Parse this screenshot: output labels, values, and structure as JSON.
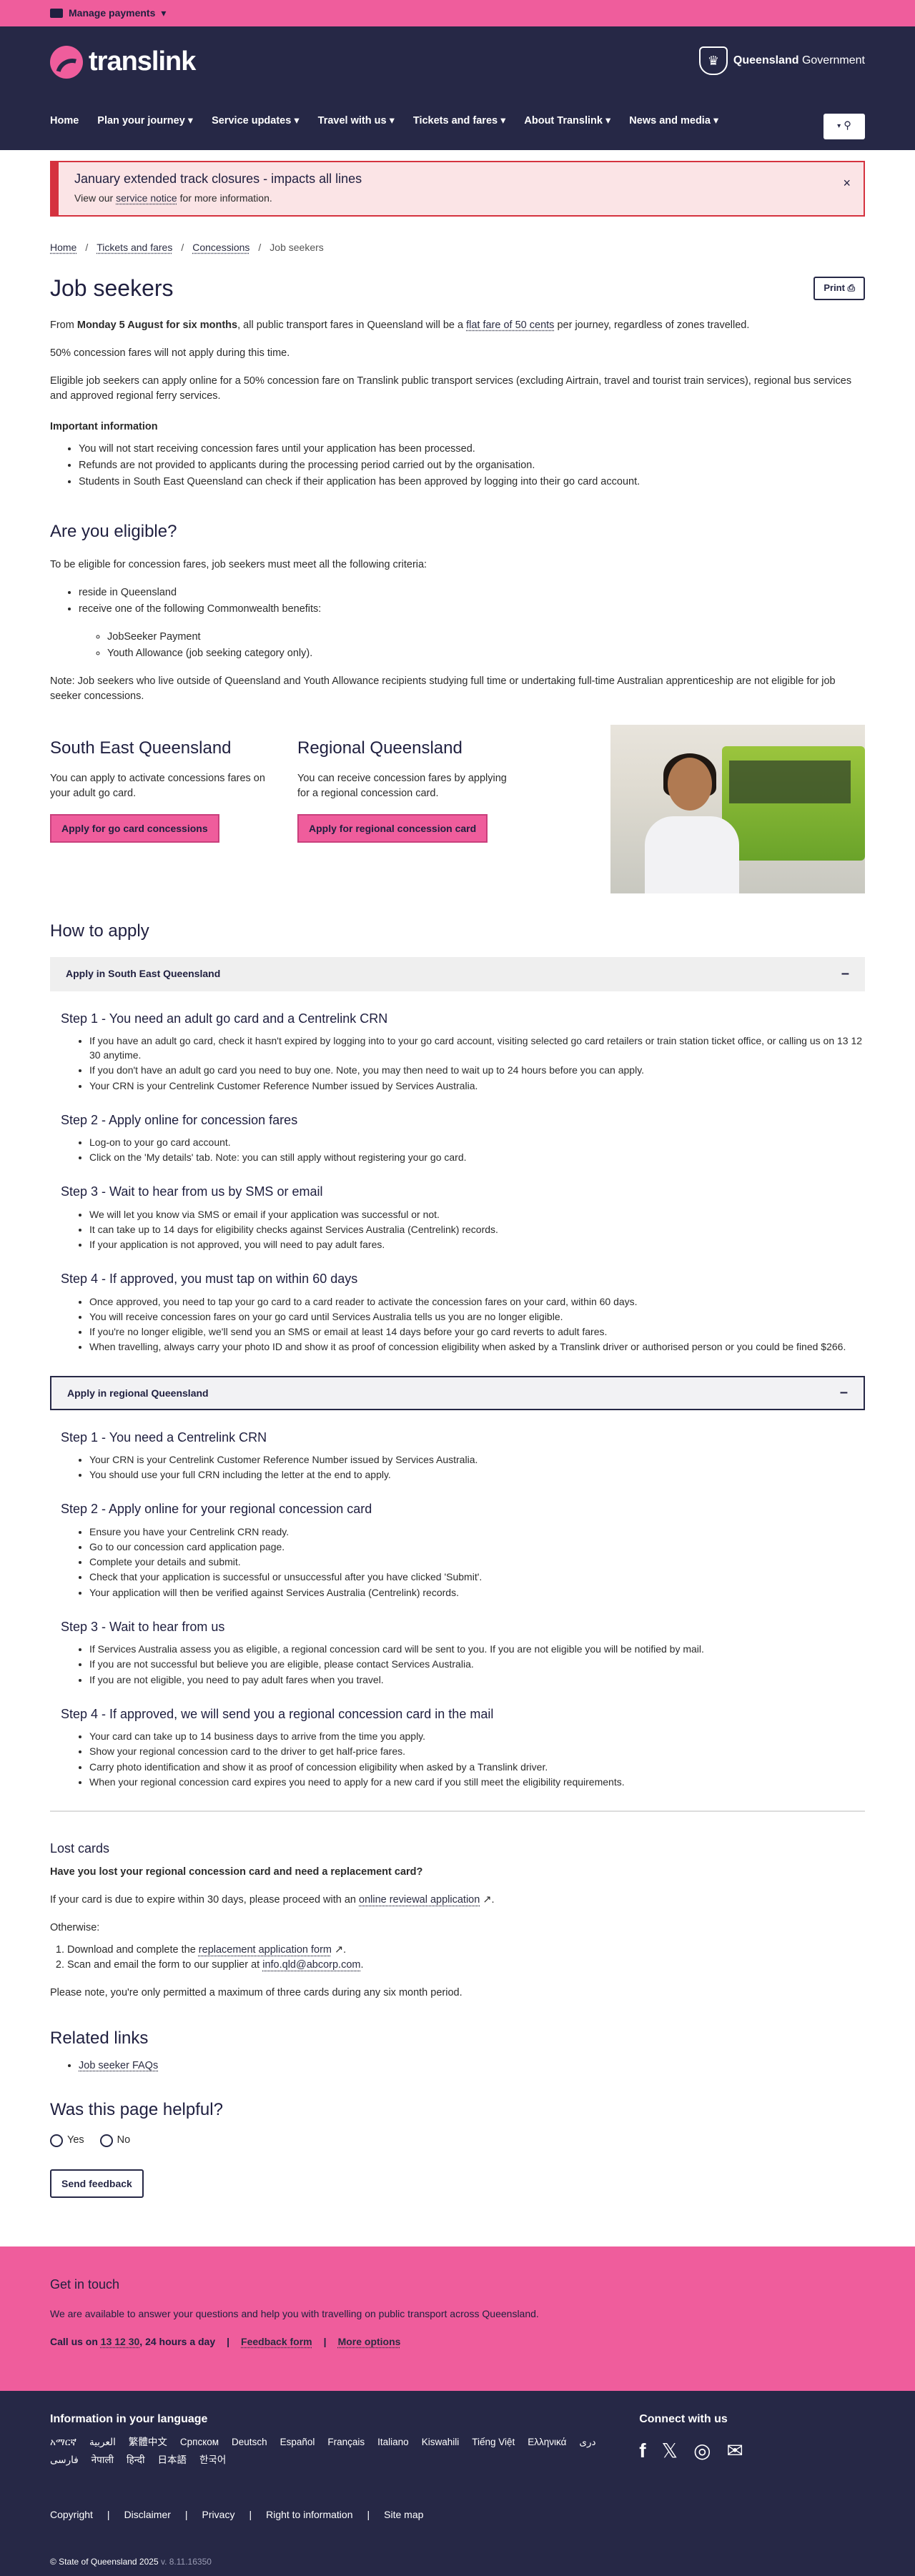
{
  "topbar": {
    "label": "Manage payments"
  },
  "header": {
    "logo": "translink",
    "gov_prefix": "Queensland",
    "gov_suffix": "Government",
    "nav": [
      "Home",
      "Plan your journey",
      "Service updates",
      "Travel with us",
      "Tickets and fares",
      "About Translink",
      "News and media"
    ]
  },
  "alert": {
    "title": "January extended track closures - impacts all lines",
    "pre": "View our",
    "link": "service notice",
    "post": "for more information.",
    "close": "×"
  },
  "breadcrumb": [
    "Home",
    "Tickets and fares",
    "Concessions",
    "Job seekers"
  ],
  "page": {
    "title": "Job seekers",
    "print": "Print",
    "p1a": "From",
    "p1b": "Monday 5 August for six months",
    "p1c": ", all public transport fares in Queensland will be a",
    "p1link": "flat fare of 50 cents",
    "p1d": "per journey, regardless of zones travelled.",
    "p2": "50% concession fares will not apply during this time.",
    "p3": "Eligible job seekers can apply online for a 50% concession fare on Translink public transport services (excluding Airtrain, travel and tourist train services), regional bus services and approved regional ferry services.",
    "imp_h": "Important information",
    "imp": [
      "You will not start receiving concession fares until your application has been processed.",
      "Refunds are not provided to applicants during the processing period carried out by the organisation.",
      "Students in South East Queensland can check if their application has been approved by logging into their go card account."
    ],
    "elig_h": "Are you eligible?",
    "elig_p": "To be eligible for concession fares, job seekers must meet all the following criteria:",
    "elig": [
      "reside in Queensland",
      "receive one of the following Commonwealth benefits:"
    ],
    "benefits": [
      "JobSeeker Payment",
      "Youth Allowance (job seeking category only)."
    ],
    "note": "Note: Job seekers who live outside of Queensland and Youth Allowance recipients studying full time or undertaking full-time Australian apprenticeship are not eligible for job seeker concessions."
  },
  "seq": {
    "h": "South East Queensland",
    "p": "You can apply to activate concessions fares on your adult go card.",
    "btn": "Apply for go card concessions"
  },
  "reg": {
    "h": "Regional Queensland",
    "p": "You can receive concession fares by applying for a regional concession card.",
    "btn": "Apply for regional concession card"
  },
  "how": {
    "h": "How to apply",
    "acc1": "Apply in South East Queensland",
    "s1": [
      {
        "h": "Step 1 - You need an adult go card and a Centrelink CRN",
        "items": [
          "If you have an adult go card, check it hasn't expired by logging into to your go card account, visiting selected go card retailers or train station ticket office, or calling us on 13 12 30 anytime.",
          "If you don't have an adult go card you need to buy one. Note, you may then need to wait up to 24 hours before you can apply.",
          "Your CRN is your Centrelink Customer Reference Number issued by Services Australia."
        ]
      },
      {
        "h": "Step 2 - Apply online for concession fares",
        "items": [
          "Log-on to your go card account.",
          "Click on the 'My details' tab. Note: you can still apply without registering your go card."
        ]
      },
      {
        "h": "Step 3 - Wait to hear from us by SMS or email",
        "items": [
          "We will let you know via SMS or email if your application was successful or not.",
          "It can take up to 14 days for eligibility checks against Services Australia (Centrelink) records.",
          "If your application is not approved, you will need to pay adult fares."
        ]
      },
      {
        "h": "Step 4 - If approved, you must tap on within 60 days",
        "items": [
          "Once approved, you need to tap your go card to a card reader to activate the concession fares on your card, within 60 days.",
          "You will receive concession fares on your go card until Services Australia tells us you are no longer eligible.",
          "If you're no longer eligible, we'll send you an SMS or email at least 14 days before your go card reverts to adult fares.",
          "When travelling, always carry your photo ID and show it as proof of concession eligibility when asked by a Translink driver or authorised person or you could be fined $266."
        ]
      }
    ],
    "acc2": "Apply in regional Queensland",
    "s2": [
      {
        "h": "Step 1 - You need a Centrelink CRN",
        "items": [
          "Your CRN is your Centrelink Customer Reference Number issued by Services Australia.",
          "You should use your full CRN including the letter at the end to apply."
        ]
      },
      {
        "h": "Step 2 - Apply online for your regional concession card",
        "items": [
          "Ensure you have your Centrelink CRN ready.",
          "Go to our concession card application page.",
          "Complete your details and submit.",
          "Check that your application is successful or unsuccessful after you have clicked 'Submit'.",
          "Your application will then be verified against Services Australia (Centrelink) records."
        ]
      },
      {
        "h": "Step 3 - Wait to hear from us",
        "items": [
          "If Services Australia assess you as eligible, a regional concession card will be sent to you. If you are not eligible you will be notified by mail.",
          "If you are not successful but believe you are eligible, please contact Services Australia.",
          "If you are not eligible, you need to pay adult fares when you travel."
        ]
      },
      {
        "h": "Step 4 - If approved, we will send you a regional concession card in the mail",
        "items": [
          "Your card can take up to 14 business days to arrive from the time you apply.",
          "Show your regional concession card to the driver to get half-price fares.",
          "Carry photo identification and show it as proof of concession eligibility when asked by a Translink driver.",
          "When your regional concession card expires you need to apply for a new card if you still meet the eligibility requirements."
        ]
      }
    ]
  },
  "lost": {
    "h": "Lost cards",
    "q": "Have you lost your regional concession card and need a replacement card?",
    "p1a": "If your card is due to expire within 30 days, please proceed with an",
    "p1link": "online reviewal application",
    "p1b": ".",
    "other": "Otherwise:",
    "ol1a": "Download and complete the",
    "ol1link": "replacement application form",
    "ol1b": ".",
    "ol2a": "Scan and email the form to our supplier at",
    "ol2link": "info.qld@abcorp.com",
    "ol2b": ".",
    "note": "Please note, you're only permitted a maximum of three cards during any six month period."
  },
  "related": {
    "h": "Related links",
    "link": "Job seeker FAQs"
  },
  "helpful": {
    "h": "Was this page helpful?",
    "yes": "Yes",
    "no": "No",
    "btn": "Send feedback"
  },
  "contact": {
    "h": "Get in touch",
    "p": "We are available to answer your questions and help you with travelling on public transport across Queensland.",
    "call_a": "Call us on",
    "call_num": "13 12 30",
    "call_b": ", 24 hours a day",
    "feedback": "Feedback form",
    "more": "More options"
  },
  "footer": {
    "lang_h": "Information in your language",
    "langs": [
      "አማርኛ",
      "العربية",
      "繁體中文",
      "Српском",
      "Deutsch",
      "Español",
      "Français",
      "Italiano",
      "Kiswahili",
      "Tiếng Việt",
      "Ελληνικά",
      "دری",
      "فارسی",
      "नेपाली",
      "हिन्दी",
      "日本語",
      "한국어"
    ],
    "connect_h": "Connect with us",
    "links": [
      "Copyright",
      "Disclaimer",
      "Privacy",
      "Right to information",
      "Site map"
    ],
    "copy": "© State of Queensland 2025",
    "version": "v. 8.11.16350"
  },
  "colors": {
    "pink": "#ef5d9c",
    "navy": "#262846",
    "alert_red": "#d5323f"
  }
}
